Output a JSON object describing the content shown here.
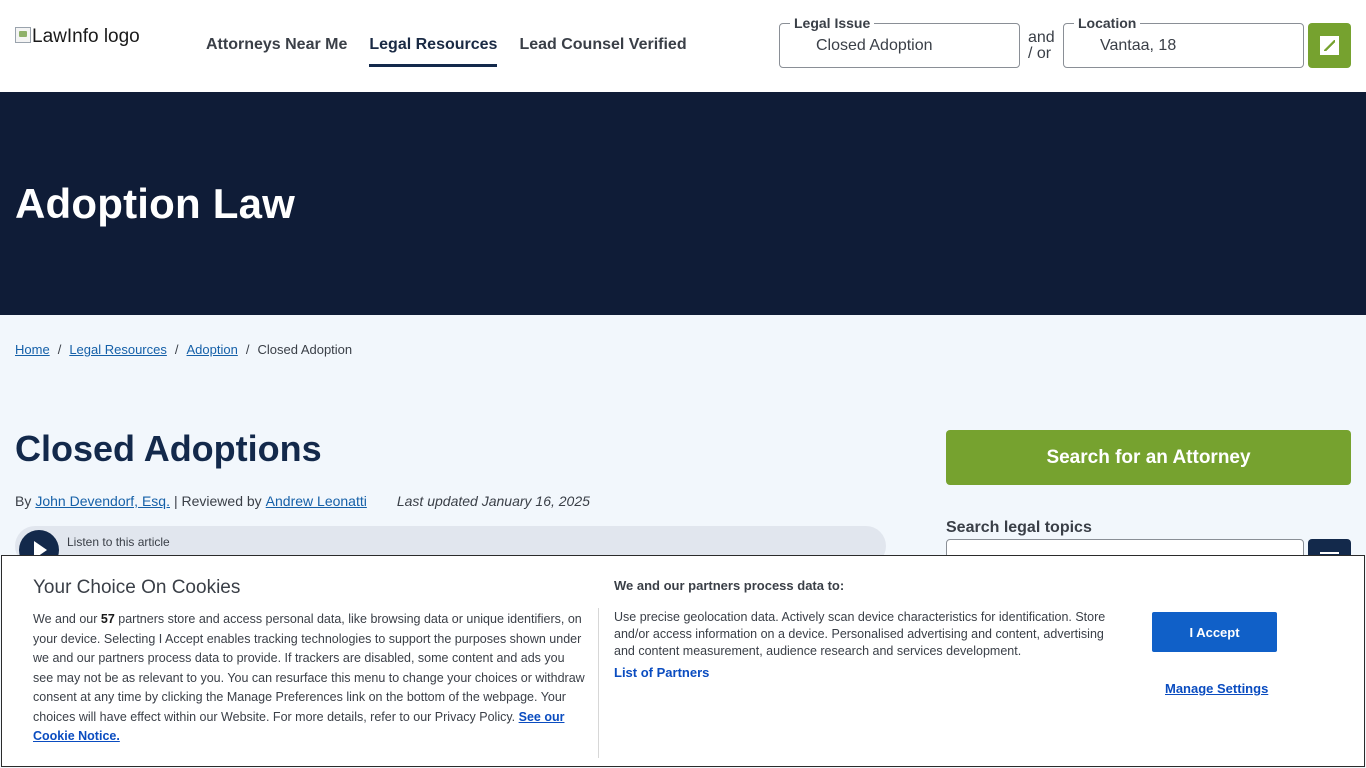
{
  "header": {
    "logo_alt": "LawInfo logo",
    "nav": [
      {
        "label": "Attorneys Near Me"
      },
      {
        "label": "Legal Resources"
      },
      {
        "label": "Lead Counsel Verified"
      }
    ],
    "legal_issue": {
      "legend": "Legal Issue",
      "value": "Closed Adoption"
    },
    "and_or": "and / or",
    "location": {
      "legend": "Location",
      "value": "Vantaa, 18"
    },
    "go_icon": "edit-icon"
  },
  "hero": {
    "title": "Adoption Law"
  },
  "breadcrumb": {
    "home": "Home",
    "legal_resources": "Legal Resources",
    "adoption": "Adoption",
    "current": "Closed Adoption",
    "sep": "/"
  },
  "article": {
    "title": "Closed Adoptions",
    "by": "By",
    "author": "John Devendorf, Esq.",
    "reviewed_by": "| Reviewed by",
    "reviewer": "Andrew Leonatti",
    "updated": "Last updated January 16, 2025",
    "listen": "Listen to this article"
  },
  "sidebar": {
    "search_attorney": "Search for an Attorney",
    "search_topics_label": "Search legal topics"
  },
  "cookie": {
    "title": "Your Choice On Cookies",
    "desc_1": "We and our ",
    "partner_count": "57",
    "desc_2": " partners store and access personal data, like browsing data or unique identifiers, on your device. Selecting I Accept enables tracking technologies to support the purposes shown under we and our partners process data to provide. If trackers are disabled, some content and ads you see may not be as relevant to you. You can resurface this menu to change your choices or withdraw consent at any time by clicking the Manage Preferences link on the bottom of the webpage. Your choices will have effect within our Website. For more details, refer to our Privacy Policy. ",
    "notice_link": "See our Cookie Notice.",
    "purposes_title": "We and our partners process data to:",
    "purposes": "Use precise geolocation data. Actively scan device characteristics for identification. Store and/or access information on a device. Personalised advertising and content, advertising and content measurement, audience research and services development.",
    "partners_link": "List of Partners",
    "accept": "I Accept",
    "manage": "Manage Settings"
  },
  "colors": {
    "navy": "#0f1c37",
    "green": "#76a22f",
    "link": "#1560a8",
    "accept_blue": "#1060c8"
  }
}
